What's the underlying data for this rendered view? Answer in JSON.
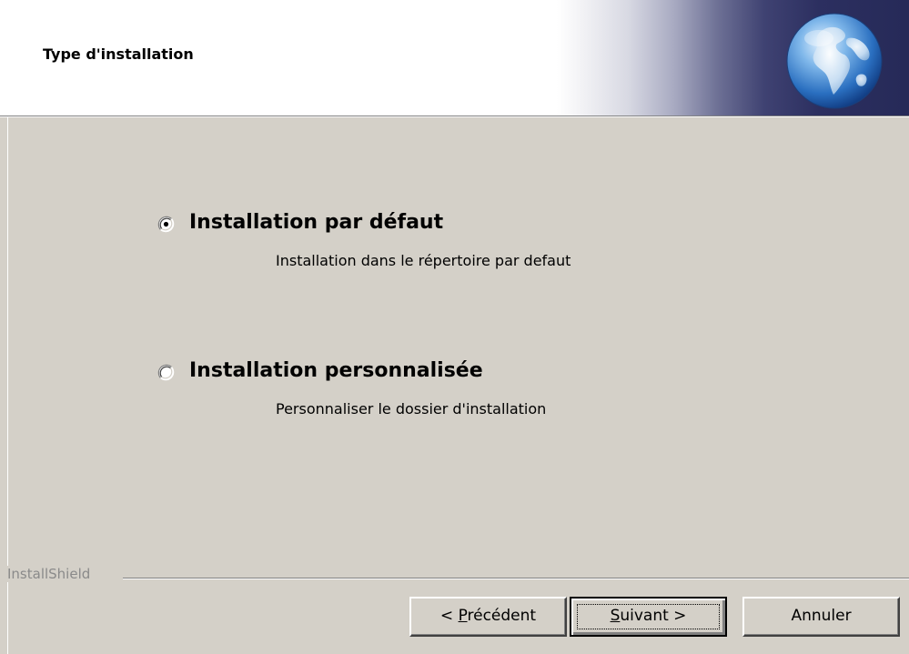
{
  "header": {
    "title": "Type d'installation"
  },
  "options": [
    {
      "label": "Installation par défaut",
      "description": "Installation dans le répertoire par defaut",
      "selected": true
    },
    {
      "label": "Installation personnalisée",
      "description": "Personnaliser le dossier d'installation",
      "selected": false
    }
  ],
  "footer": {
    "brand": "InstallShield"
  },
  "buttons": {
    "back": {
      "prefix": "< ",
      "mnemonic": "P",
      "rest": "récédent"
    },
    "next": {
      "mnemonic": "S",
      "rest": "uivant >"
    },
    "cancel": "Annuler"
  },
  "colors": {
    "dialog_bg": "#d4d0c8",
    "header_bg": "#ffffff",
    "header_gradient_dark": "#262a58",
    "brand_text": "#8a8a8a"
  },
  "icons": {
    "header_logo": "globe-icon",
    "radio_selected": "radio-checked-icon",
    "radio_unselected": "radio-unchecked-icon"
  }
}
